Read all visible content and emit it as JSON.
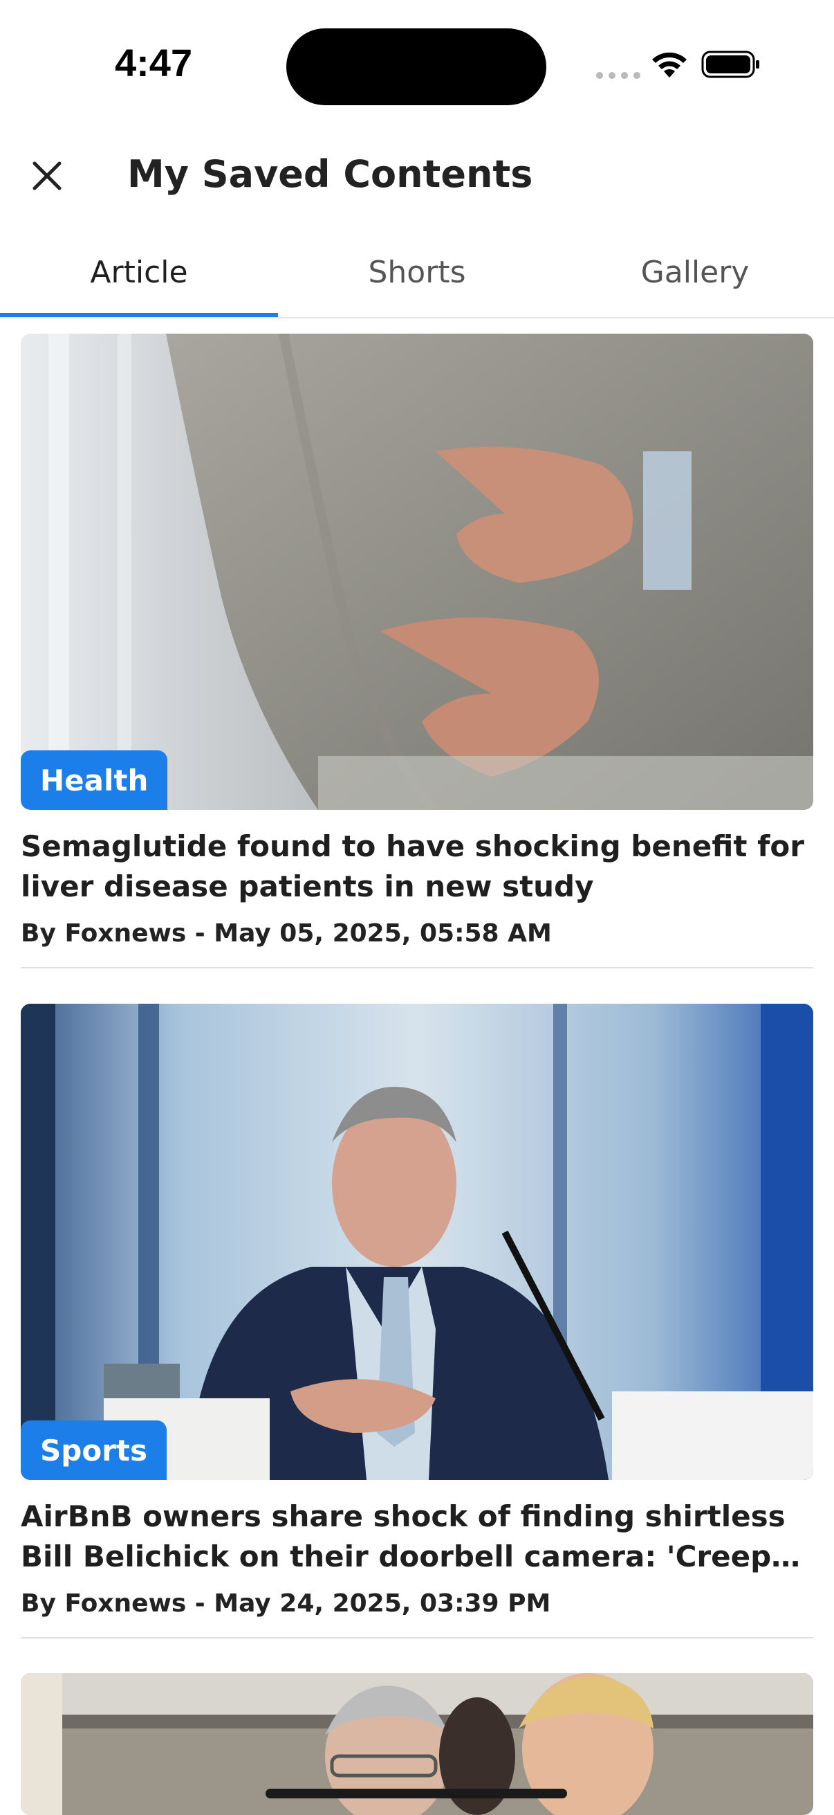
{
  "status_bar": {
    "time": "4:47"
  },
  "header": {
    "title": "My Saved Contents",
    "close_icon": "close-icon"
  },
  "tabs": [
    {
      "label": "Article",
      "active": true
    },
    {
      "label": "Shorts",
      "active": false
    },
    {
      "label": "Gallery",
      "active": false
    }
  ],
  "articles": [
    {
      "category": "Health",
      "title": "Semaglutide found to have shocking benefit for liver disease patients in new study",
      "meta": "By Foxnews - May 05, 2025, 05:58 AM"
    },
    {
      "category": "Sports",
      "title": "AirBnB owners share shock of finding shirtless Bill Belichick on their doorbell camera: 'Creepy old g…",
      "meta": "By Foxnews - May 24, 2025, 03:39 PM"
    }
  ],
  "colors": {
    "accent": "#1c7ee8",
    "text": "#1f1f1f",
    "divider": "#e0e0e0"
  }
}
